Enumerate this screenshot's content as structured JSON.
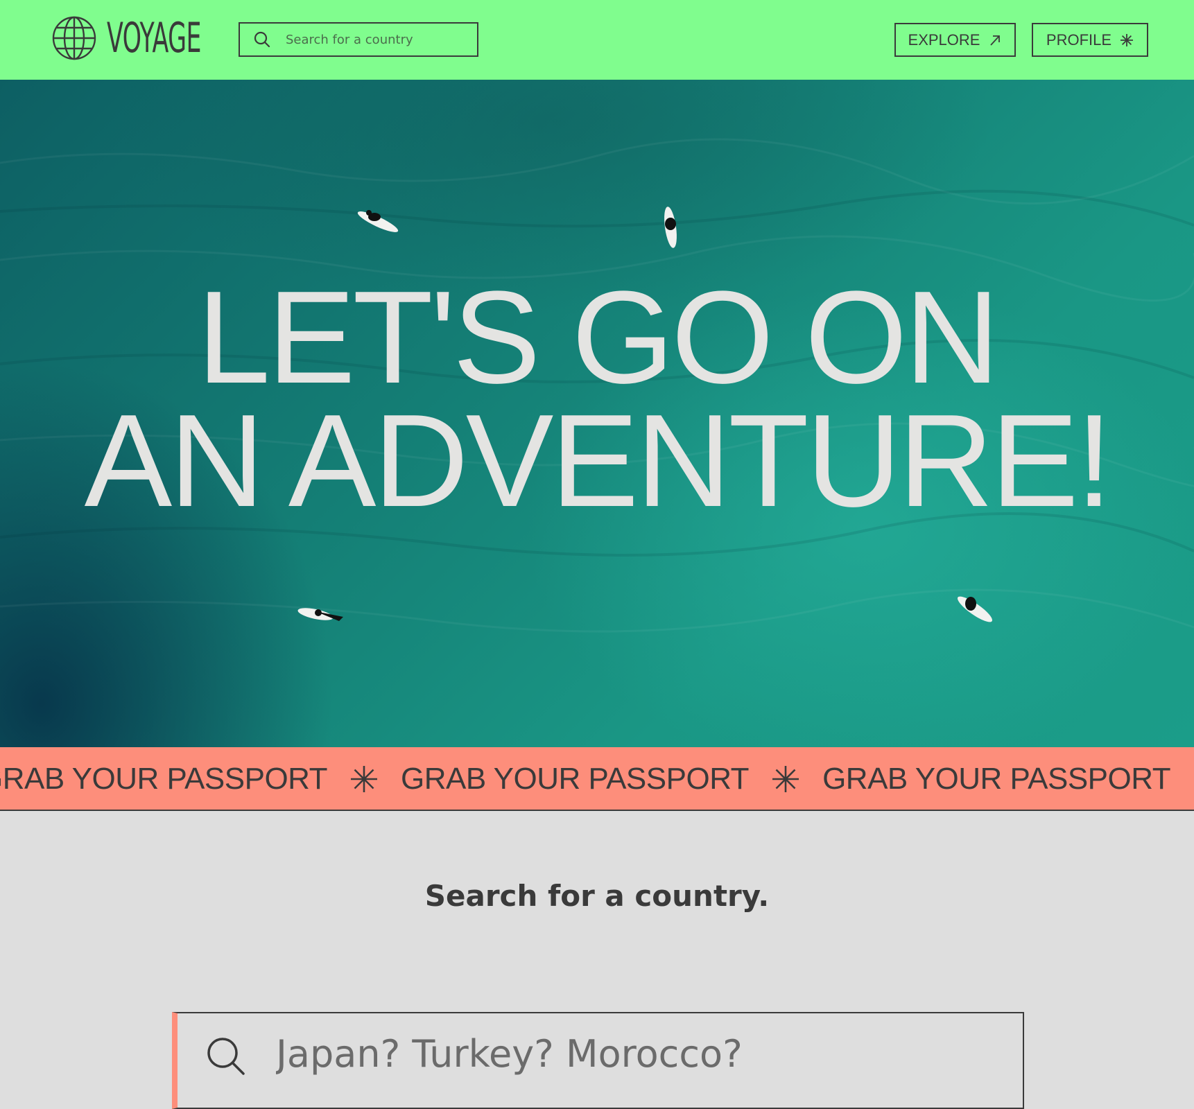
{
  "brand": {
    "name": "VOYAGE",
    "logo_icon": "globe-icon",
    "colors": {
      "header_bg": "#80fd8e",
      "marquee_bg": "#fd8e7b",
      "text": "#3a3a3a",
      "page_bg": "#dedede"
    }
  },
  "header": {
    "search": {
      "placeholder": "Search for a country",
      "icon": "search-icon"
    },
    "nav": [
      {
        "label": "EXPLORE",
        "icon": "arrow-up-right-icon"
      },
      {
        "label": "PROFILE",
        "icon": "asterisk-icon"
      }
    ]
  },
  "hero": {
    "title_line1": "LET'S GO ON",
    "title_line2": "AN ADVENTURE!"
  },
  "marquee": {
    "items": [
      "GRAB YOUR PASSPORT",
      "GRAB YOUR PASSPORT",
      "GRAB YOUR PASSPORT"
    ],
    "separator_icon": "asterisk-icon"
  },
  "search_section": {
    "heading": "Search for a country.",
    "placeholder": "Japan? Turkey? Morocco?",
    "icon": "search-icon"
  }
}
